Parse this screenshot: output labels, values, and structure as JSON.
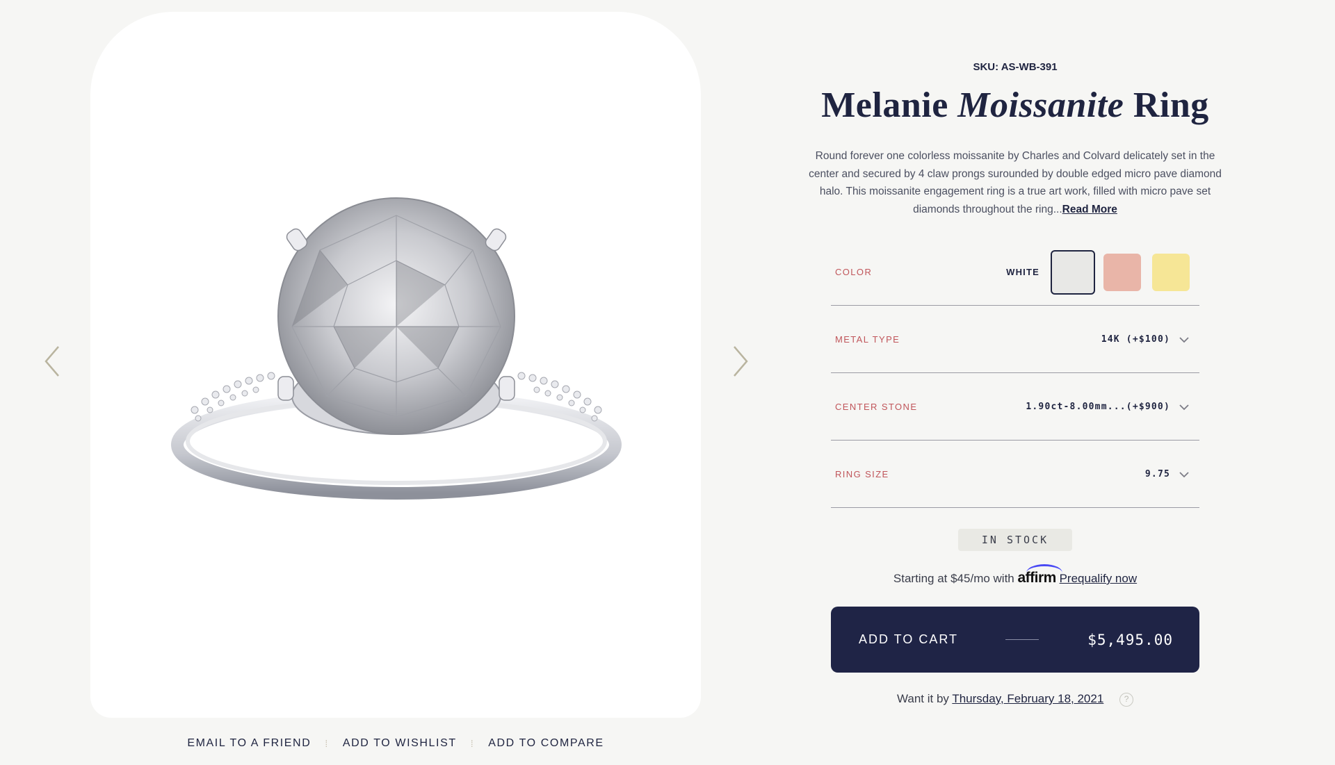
{
  "gallery": {
    "image_alt": "ring-image",
    "actions": [
      {
        "label": "EMAIL TO A FRIEND"
      },
      {
        "label": "ADD TO WISHLIST"
      },
      {
        "label": "ADD TO COMPARE"
      }
    ],
    "separator": "⁞"
  },
  "product": {
    "sku": "SKU: AS-WB-391",
    "title_part1": "Melanie",
    "title_em": "Moissanite",
    "title_part2": "Ring",
    "description": "Round forever one colorless moissanite by Charles and Colvard delicately set in the center and secured by 4 claw prongs surounded by double edged micro pave diamond halo. This moissanite engagement ring is a true art work, filled with micro pave set diamonds throughout the ring...",
    "read_more": "Read More"
  },
  "options": {
    "color": {
      "label": "COLOR",
      "selected": "WHITE",
      "swatches": [
        {
          "name": "white",
          "hex": "#e8e8e6"
        },
        {
          "name": "rose",
          "hex": "#e9b5a8"
        },
        {
          "name": "yellow",
          "hex": "#f6e696"
        }
      ]
    },
    "metal_type": {
      "label": "METAL TYPE",
      "value": "14K (+$100)"
    },
    "center_stone": {
      "label": "CENTER STONE",
      "value": "1.90ct-8.00mm...(+$900)"
    },
    "ring_size": {
      "label": "RING SIZE",
      "value": "9.75"
    }
  },
  "stock": {
    "label": "IN STOCK"
  },
  "financing": {
    "prefix": "Starting at $45/mo with",
    "provider": "affirm",
    "link": "Prequalify now"
  },
  "cart": {
    "label": "ADD TO CART",
    "price": "$5,495.00"
  },
  "delivery": {
    "prefix": "Want it by",
    "date": "Thursday, February 18, 2021",
    "help": "?"
  },
  "colors": {
    "navy": "#1f2446",
    "accent_label": "#c0555a",
    "background": "#f6f6f4"
  }
}
